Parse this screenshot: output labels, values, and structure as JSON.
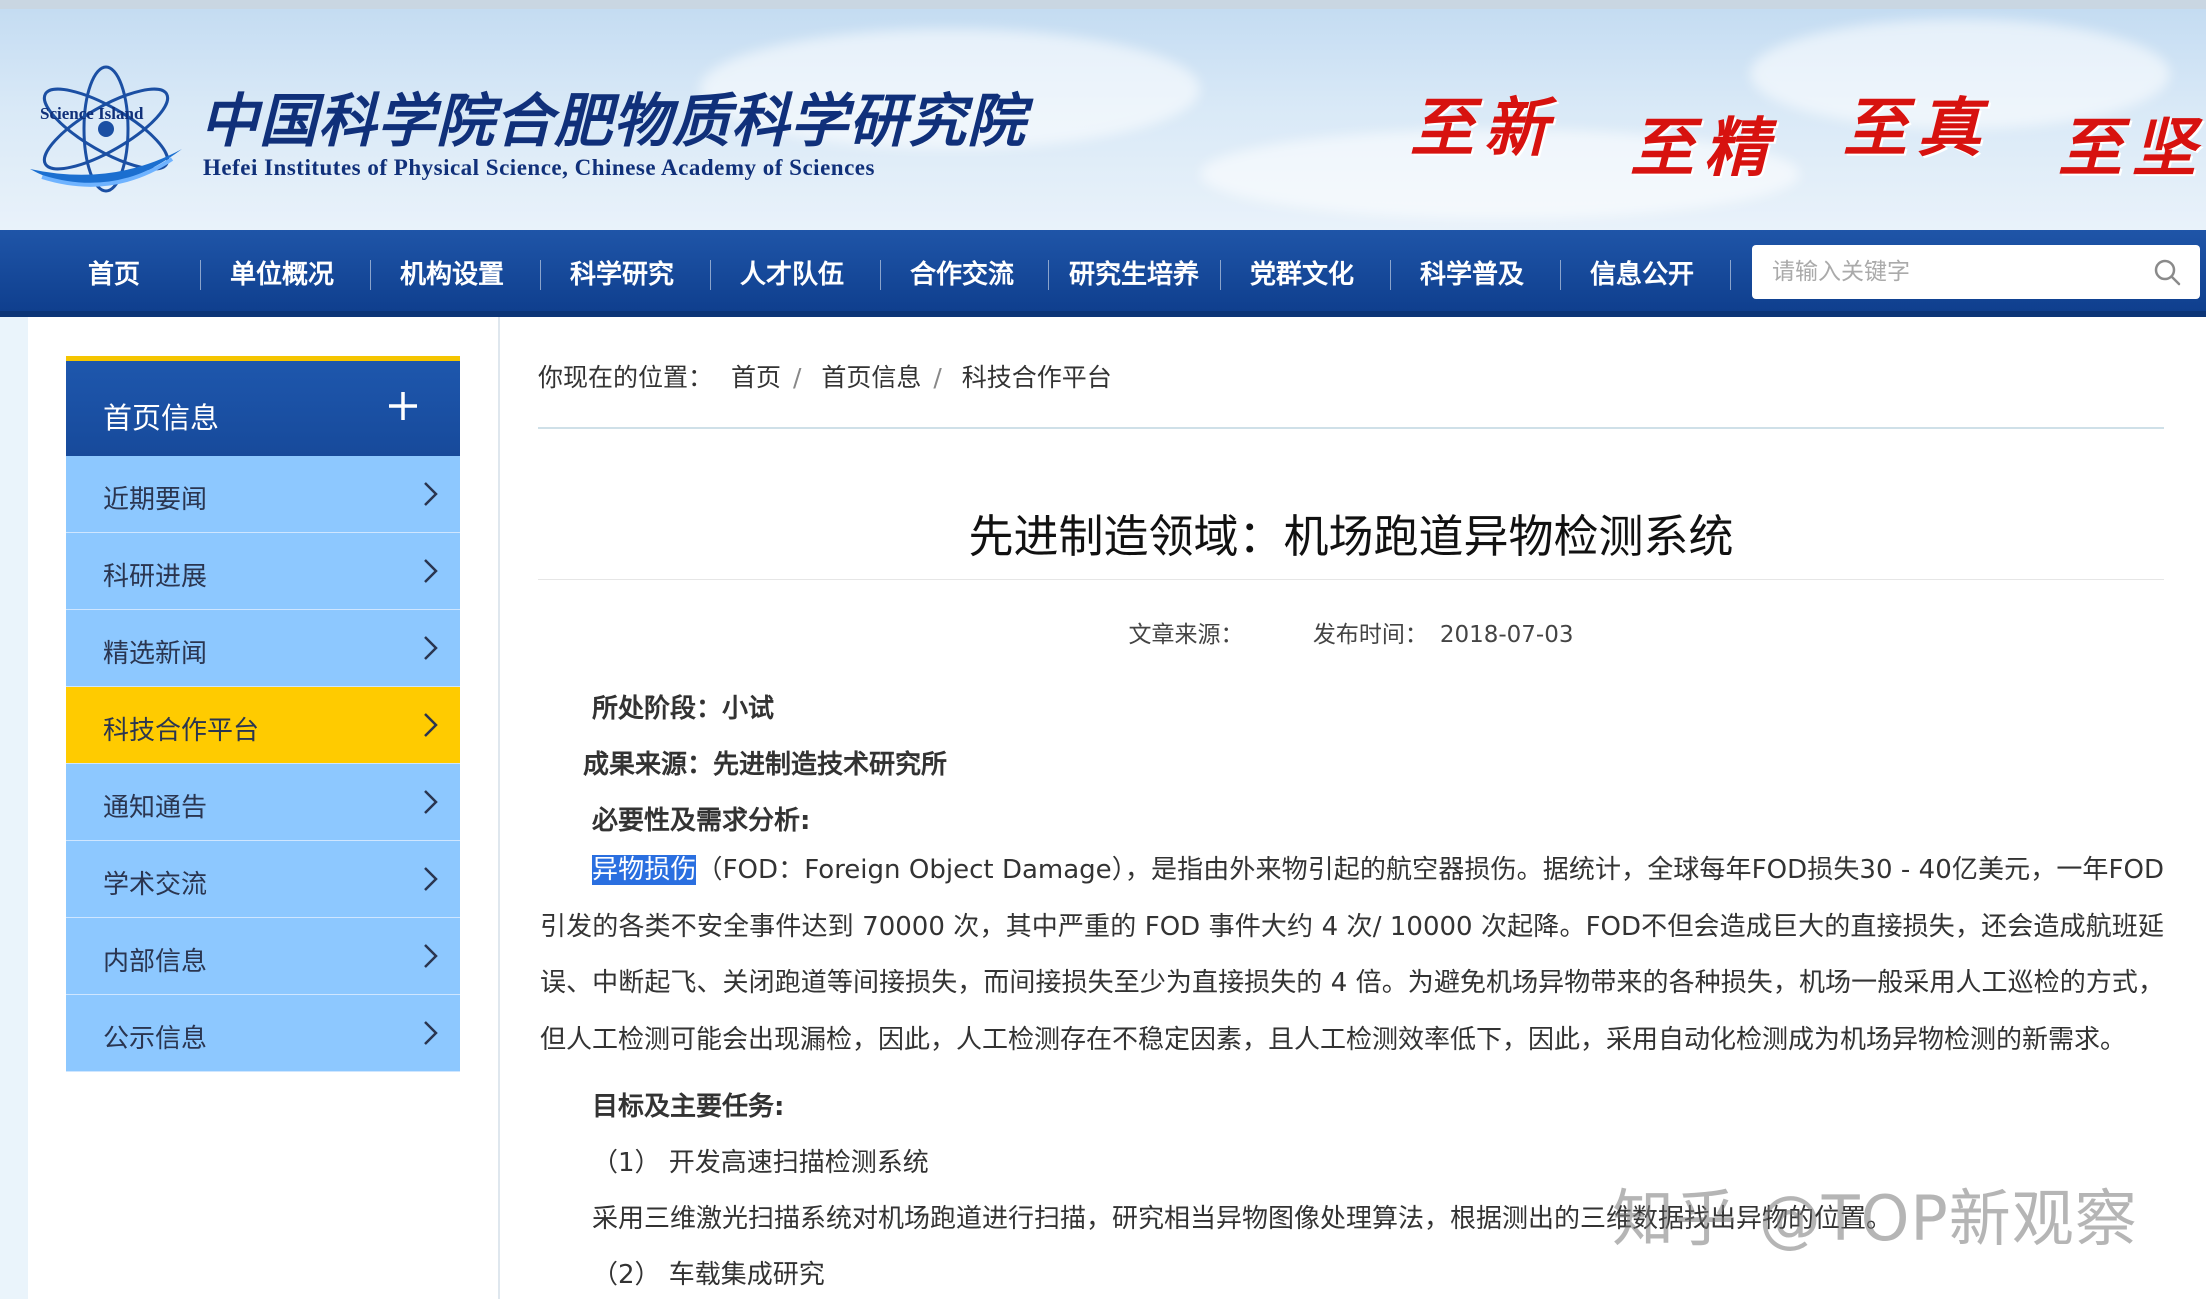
{
  "header": {
    "logo_badge": "Science Island",
    "org_name_cn": "中国科学院合肥物质科学研究院",
    "org_name_en": "Hefei Institutes of Physical Science, Chinese Academy of Sciences",
    "motto": [
      "至新",
      "至精",
      "至真",
      "至坚"
    ]
  },
  "nav": {
    "items": [
      "首页",
      "单位概况",
      "机构设置",
      "科学研究",
      "人才队伍",
      "合作交流",
      "研究生培养",
      "党群文化",
      "科学普及",
      "信息公开"
    ],
    "search_placeholder": "请输入关键字"
  },
  "sidebar": {
    "title": "首页信息",
    "items": [
      "近期要闻",
      "科研进展",
      "精选新闻",
      "科技合作平台",
      "通知通告",
      "学术交流",
      "内部信息",
      "公示信息"
    ],
    "active": "科技合作平台"
  },
  "breadcrumb": {
    "prefix": "你现在的位置：",
    "items": [
      "首页",
      "首页信息",
      "科技合作平台"
    ]
  },
  "article": {
    "title": "先进制造领域：机场跑道异物检测系统",
    "source_label": "文章来源：",
    "date_label": "发布时间：",
    "date": "2018-07-03",
    "stage": "所处阶段：小试",
    "origin": "成果来源：先进制造技术研究所",
    "need_heading": "必要性及需求分析:",
    "need_highlight": "异物损伤",
    "need_text": "（FOD：Foreign Object Damage），是指由外来物引起的航空器损伤。据统计，全球每年FOD损失30 - 40亿美元，一年FOD引发的各类不安全事件达到 70000 次，其中严重的 FOD 事件大约 4 次/ 10000 次起降。FOD不但会造成巨大的直接损失，还会造成航班延误、中断起飞、关闭跑道等间接损失，而间接损失至少为直接损失的 4 倍。为避免机场异物带来的各种损失，机场一般采用人工巡检的方式，但人工检测可能会出现漏检，因此，人工检测存在不稳定因素，且人工检测效率低下，因此，采用自动化检测成为机场异物检测的新需求。",
    "goal_heading": "目标及主要任务:",
    "task1": "（1） 开发高速扫描检测系统",
    "task1_desc": "采用三维激光扫描系统对机场跑道进行扫描，研究相当异物图像处理算法，根据测出的三维数据找出异物的位置。",
    "task2": "（2） 车载集成研究"
  },
  "watermark": "知乎 @TOP新观察",
  "colors": {
    "nav_blue": "#134496",
    "sidebar_item": "#8dc8ff",
    "sidebar_active": "#ffcb00",
    "motto_red": "#d7120f"
  }
}
